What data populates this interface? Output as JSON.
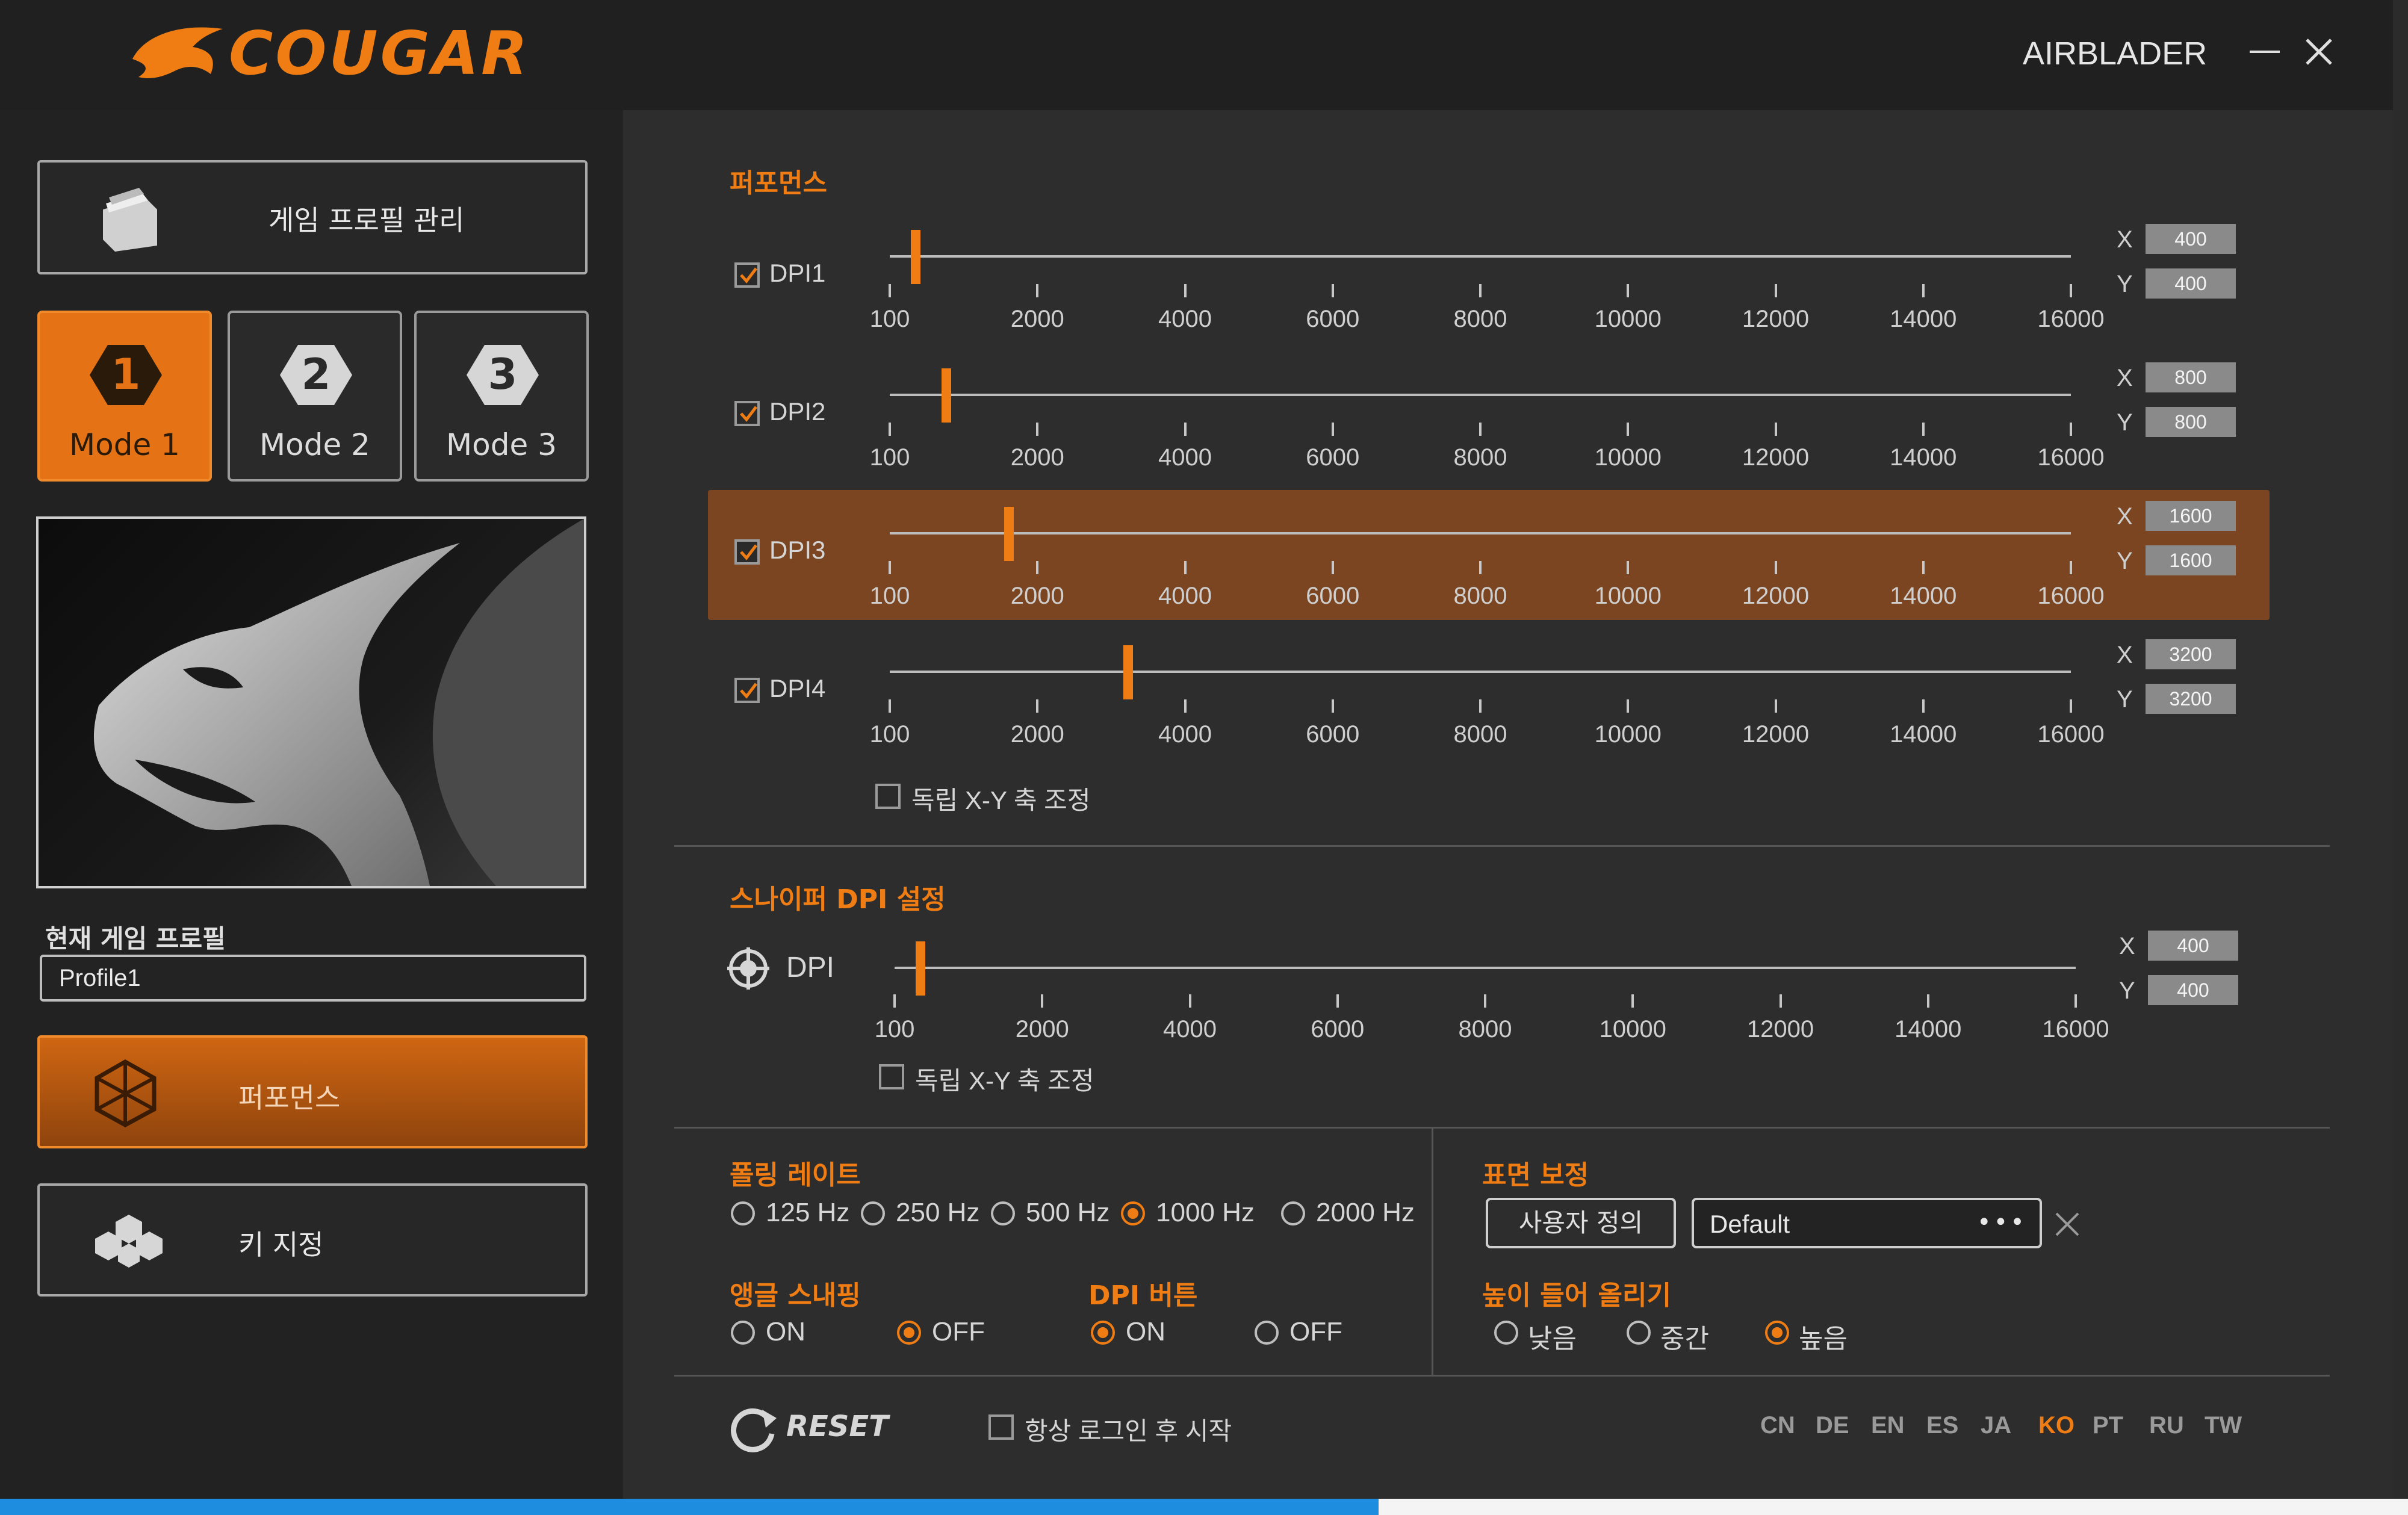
{
  "app": {
    "brand": "COUGAR",
    "device": "AIRBLADER"
  },
  "sidebar": {
    "profile_manage_label": "게임 프로필 관리",
    "modes": [
      {
        "num": "1",
        "label": "Mode 1",
        "active": true
      },
      {
        "num": "2",
        "label": "Mode 2",
        "active": false
      },
      {
        "num": "3",
        "label": "Mode 3",
        "active": false
      }
    ],
    "current_profile_label": "현재 게임 프로필",
    "current_profile_value": "Profile1",
    "performance_label": "퍼포먼스",
    "key_assign_label": "키 지정"
  },
  "performance": {
    "title": "퍼포먼스",
    "scale": {
      "min": 100,
      "max": 16000,
      "ticks": [
        "100",
        "2000",
        "4000",
        "6000",
        "8000",
        "10000",
        "12000",
        "14000",
        "16000"
      ]
    },
    "rows": [
      {
        "label": "DPI1",
        "checked": true,
        "x": "400",
        "y": "400",
        "value": 400,
        "selected": false
      },
      {
        "label": "DPI2",
        "checked": true,
        "x": "800",
        "y": "800",
        "value": 800,
        "selected": false
      },
      {
        "label": "DPI3",
        "checked": true,
        "x": "1600",
        "y": "1600",
        "value": 1600,
        "selected": true
      },
      {
        "label": "DPI4",
        "checked": true,
        "x": "3200",
        "y": "3200",
        "value": 3200,
        "selected": false
      }
    ],
    "independent_xy_label": "독립 X-Y 축 조정",
    "x_label": "X",
    "y_label": "Y"
  },
  "sniper": {
    "title": "스나이퍼 DPI 설정",
    "label": "DPI",
    "x": "400",
    "y": "400",
    "value": 400,
    "independent_xy_label": "독립 X-Y 축 조정"
  },
  "polling": {
    "title": "폴링 레이트",
    "options": [
      {
        "label": "125 Hz",
        "on": false
      },
      {
        "label": "250 Hz",
        "on": false
      },
      {
        "label": "500 Hz",
        "on": false
      },
      {
        "label": "1000 Hz",
        "on": true
      },
      {
        "label": "2000 Hz",
        "on": false
      }
    ]
  },
  "angle_snapping": {
    "title": "앵글 스내핑",
    "on_label": "ON",
    "off_label": "OFF",
    "value": "OFF"
  },
  "dpi_button": {
    "title": "DPI 버튼",
    "on_label": "ON",
    "off_label": "OFF",
    "value": "ON"
  },
  "surface": {
    "title": "표면 보정",
    "custom_label": "사용자 정의",
    "select_value": "Default",
    "more": "•••"
  },
  "lift_off": {
    "title": "높이 들어 올리기",
    "options": [
      {
        "label": "낮음",
        "on": false
      },
      {
        "label": "중간",
        "on": false
      },
      {
        "label": "높음",
        "on": true
      }
    ]
  },
  "footer": {
    "reset_label": "RESET",
    "always_start_label": "항상 로그인 후 시작",
    "languages": [
      "CN",
      "DE",
      "EN",
      "ES",
      "JA",
      "KO",
      "PT",
      "RU",
      "TW"
    ],
    "active_language": "KO"
  },
  "colors": {
    "accent": "#f07d14",
    "background": "#2d2d2d",
    "sidebar": "#222222"
  }
}
